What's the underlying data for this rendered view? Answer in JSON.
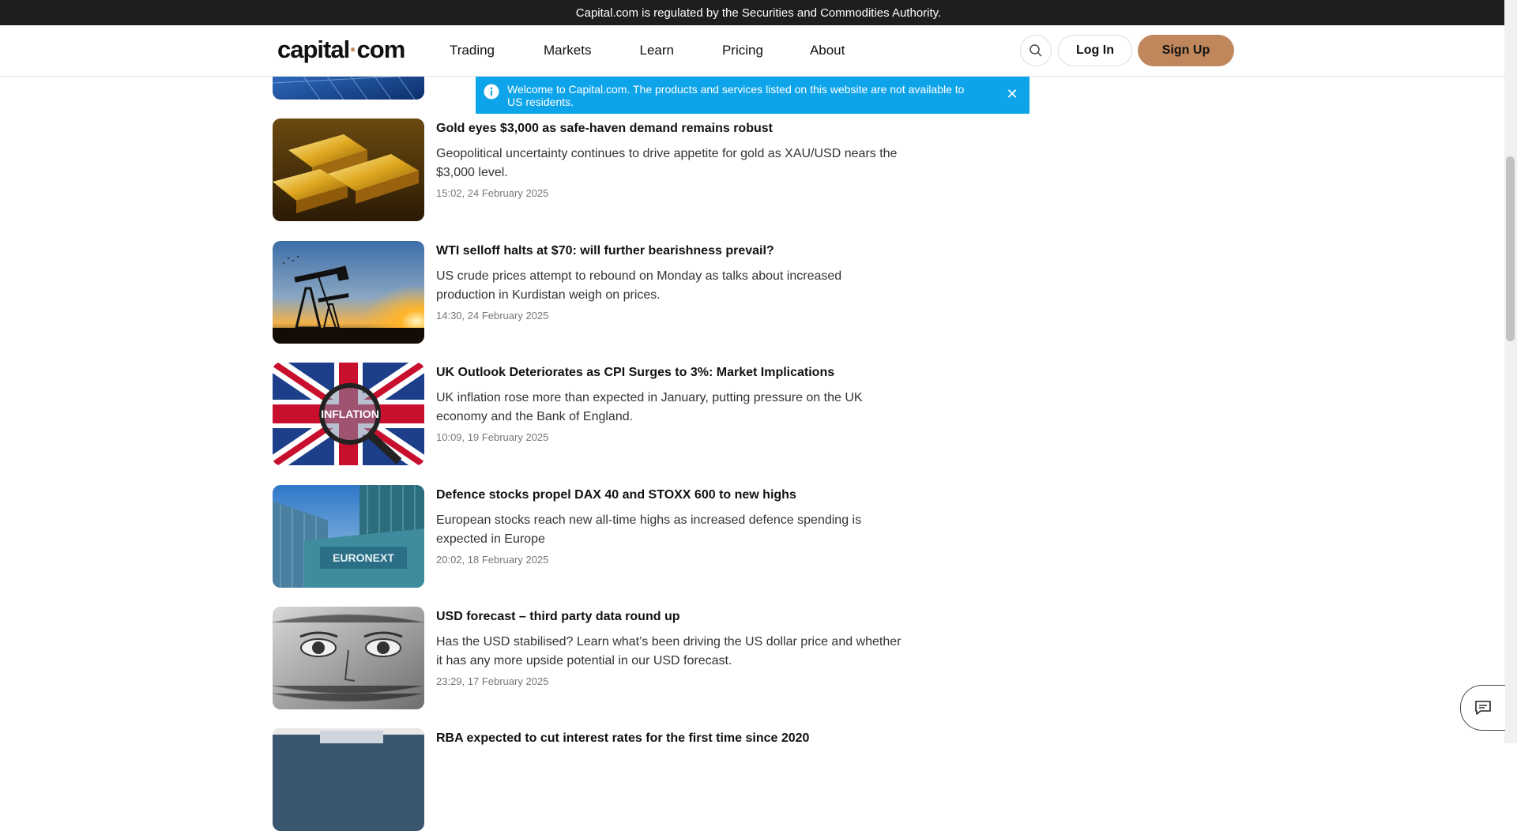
{
  "topbar": {
    "text": "Capital.com is regulated by the Securities and Commodities Authority."
  },
  "header": {
    "logo_text_a": "capital",
    "logo_dot": "·",
    "logo_text_b": "com",
    "nav": [
      "Trading",
      "Markets",
      "Learn",
      "Pricing",
      "About"
    ],
    "search_icon": "search-icon",
    "login_label": "Log In",
    "signup_label": "Sign Up",
    "accent_color": "#c0875c"
  },
  "banner": {
    "text": "Welcome to Capital.com. The products and services listed on this website are not available to US residents.",
    "icon": "info-icon",
    "close_label": "✕",
    "color": "#0ea4ea"
  },
  "articles": [
    {
      "title": "Gold eyes $3,000 as safe-haven demand remains robust",
      "description": "Geopolitical uncertainty continues to drive appetite for gold as XAU/USD nears the $3,000 level.",
      "date": "15:02, 24 February 2025"
    },
    {
      "title": "WTI selloff halts at $70: will further bearishness prevail?",
      "description": "US crude prices attempt to rebound on Monday as talks about increased production in Kurdistan weigh on prices.",
      "date": "14:30, 24 February 2025"
    },
    {
      "title": "UK Outlook Deteriorates as CPI Surges to 3%: Market Implications",
      "description": "UK inflation rose more than expected in January, putting pressure on the UK economy and the Bank of England.",
      "date": "10:09, 19 February 2025",
      "image_text": "INFLATION"
    },
    {
      "title": "Defence stocks propel DAX 40 and STOXX 600 to new highs",
      "description": "European stocks reach new all-time highs as increased defence spending is expected in Europe",
      "date": "20:02, 18 February 2025",
      "image_text": "EURONEXT"
    },
    {
      "title": "USD forecast – third party data round up",
      "description": "Has the USD stabilised? Learn what’s been driving the US dollar price and whether it has any more upside potential in our USD forecast.",
      "date": "23:29, 17 February 2025"
    },
    {
      "title": "RBA expected to cut interest rates for the first time since 2020",
      "description": "",
      "date": ""
    }
  ],
  "chat": {
    "icon": "chat-icon"
  }
}
